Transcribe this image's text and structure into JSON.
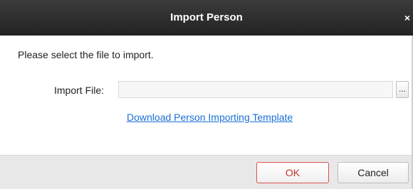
{
  "dialog": {
    "title": "Import Person",
    "close_label": "×"
  },
  "content": {
    "instruction": "Please select the file to import.",
    "file_label": "Import File:",
    "file_value": "",
    "browse_label": "...",
    "template_link": "Download Person Importing Template"
  },
  "footer": {
    "ok_label": "OK",
    "cancel_label": "Cancel"
  },
  "colors": {
    "titlebar": "#2e2e2e",
    "link": "#1a6fd8",
    "ok_border": "#d9534f",
    "footer_bg": "#e8e8e8"
  }
}
